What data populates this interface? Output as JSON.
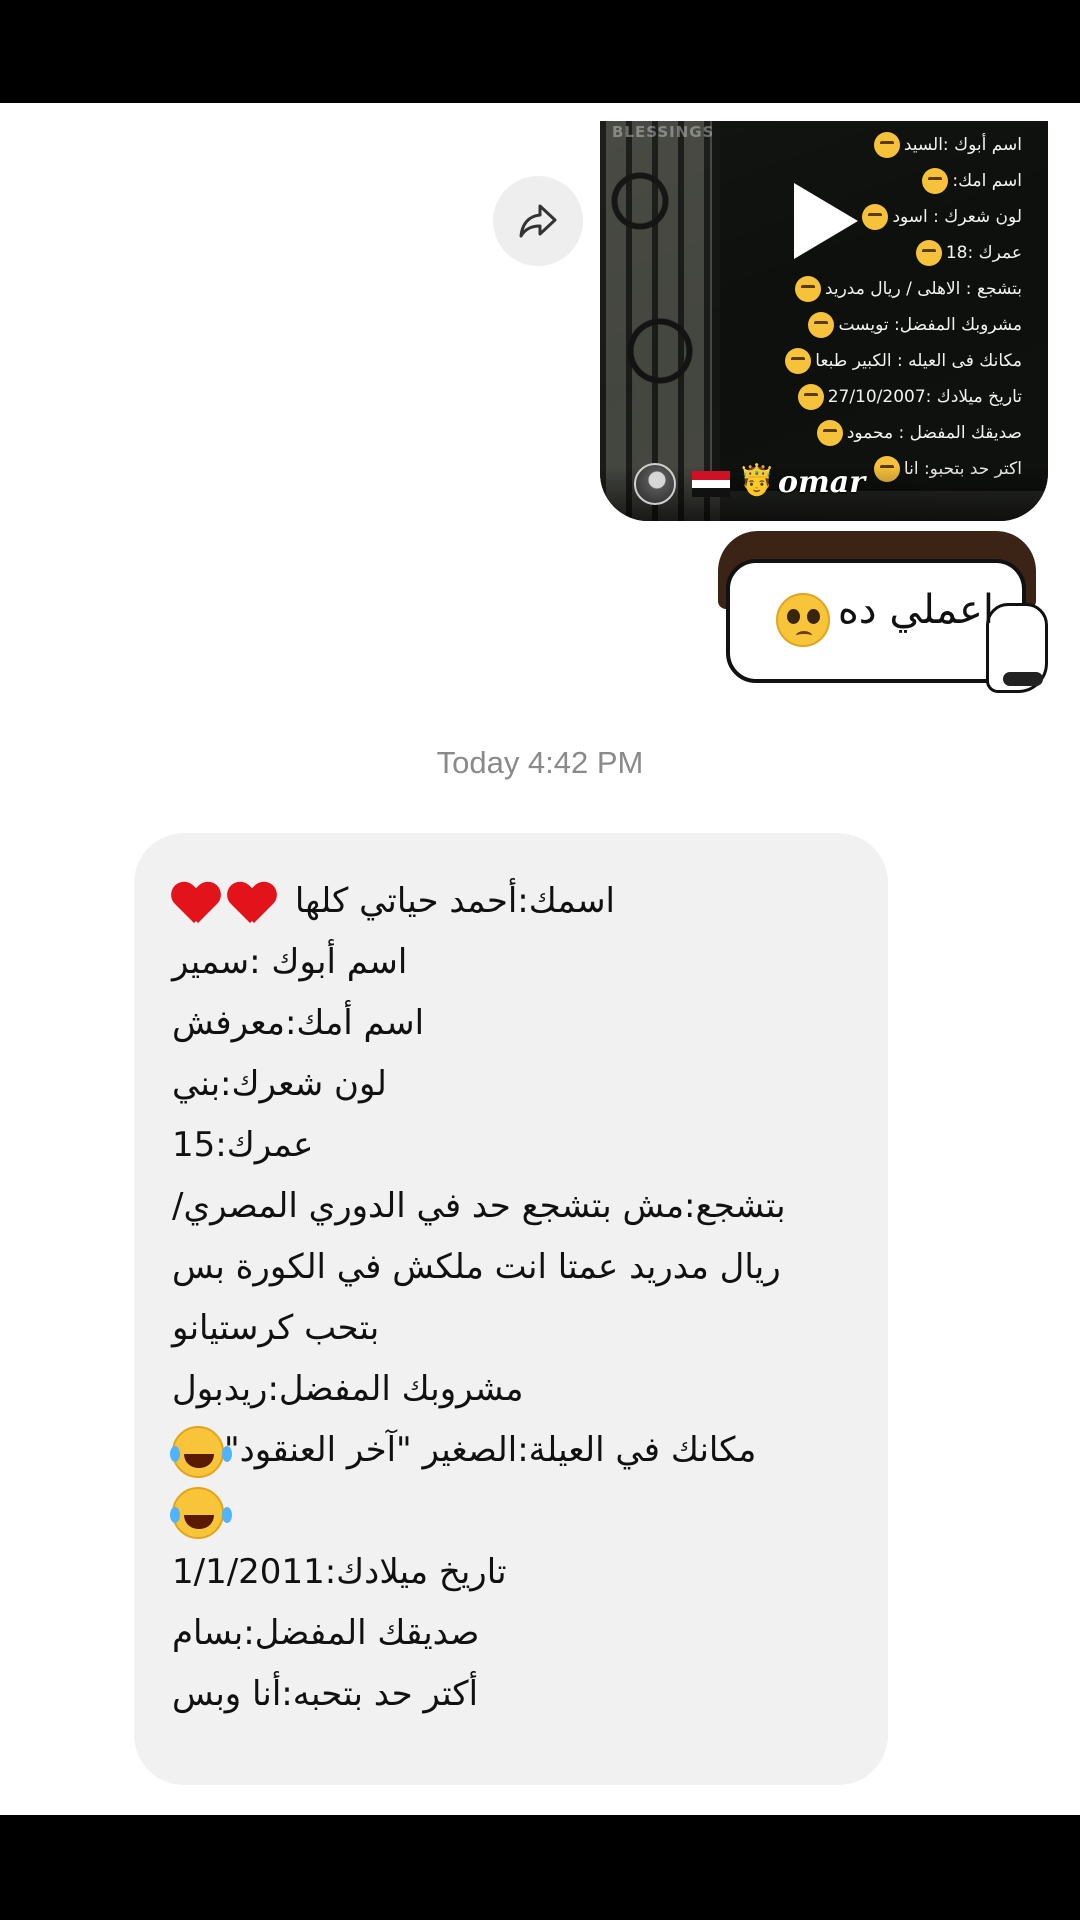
{
  "reel": {
    "watermark": "BLESSINGS",
    "info_lines": [
      "اسم أبوك :السيد",
      "اسم امك:",
      "لون شعرك : اسود",
      "عمرك :18",
      "بتشجع : الاهلى / ريال مدريد",
      "مشروبك المفضل: تويست",
      "مكانك فى العيله : الكبير طبعا",
      "تاريخ ميلادك :27/10/2007",
      "صديقك المفضل : محمود",
      "اكتر حد بتحبو: انا"
    ],
    "username": "omar",
    "crown_emoji": "🤴"
  },
  "forward": {
    "icon": "forward-arrow-icon"
  },
  "sticker": {
    "text": "اعملي ده"
  },
  "timestamp": "Today 4:42 PM",
  "message": {
    "lines": [
      "اسمك:أحمد حياتي كلها",
      "اسم أبوك :سمير",
      "اسم أمك:معرفش",
      "لون شعرك:بني",
      "عمرك:15",
      "بتشجع:مش بتشجع حد في الدوري المصري/",
      "ريال مدريد عمتا انت ملكش في الكورة بس",
      "بتحب كرستيانو",
      "مشروبك المفضل:ريدبول",
      "مكانك في العيلة:الصغير \"آخر العنقود\"",
      "تاريخ ميلادك:1/1/2011",
      "صديقك المفضل:بسام",
      "أكتر حد بتحبه:أنا وبس"
    ]
  },
  "colors": {
    "bubble_bg": "#f1f1f1",
    "timestamp": "#8a8a8a",
    "heart": "#e3131b"
  }
}
